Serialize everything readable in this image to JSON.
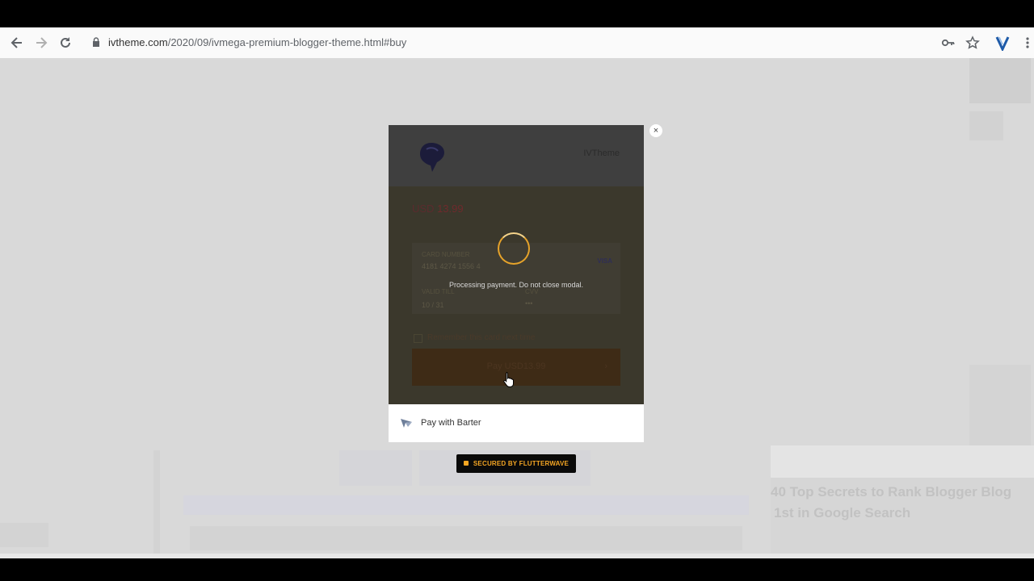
{
  "browser": {
    "url_host": "ivtheme.com",
    "url_path": "/2020/09/ivmega-premium-blogger-theme.html#buy",
    "icons": [
      "back-icon",
      "forward-icon",
      "reload-icon",
      "lock-icon",
      "key-icon",
      "star-icon",
      "extension-v-icon",
      "menu-dots-icon"
    ]
  },
  "modal": {
    "merchant": "IVTheme",
    "currency": "USD",
    "amount": "13.99",
    "card_number_label": "CARD NUMBER",
    "card_number": "4181 4274 1556 4",
    "card_brand": "VISA",
    "valid_till_label": "VALID TILL",
    "valid_till": "10 / 31",
    "cvv_label": "CVV",
    "cvv": "•••",
    "remember_label": "Remember this card next time",
    "pay_label": "Pay USD13.99",
    "processing_text": "Processing payment. Do not close modal.",
    "close": "×"
  },
  "barter": {
    "label": "Pay with Barter"
  },
  "secured": {
    "label": "SECURED BY FLUTTERWAVE"
  },
  "background_page": {
    "headline_1": "40 Top Secrets to Rank Blogger Blog",
    "headline_2": "1st in Google Search"
  },
  "colors": {
    "spinner": "#e6a32a",
    "secured_text": "#f5a623",
    "overlay": "#d9d9d9"
  }
}
